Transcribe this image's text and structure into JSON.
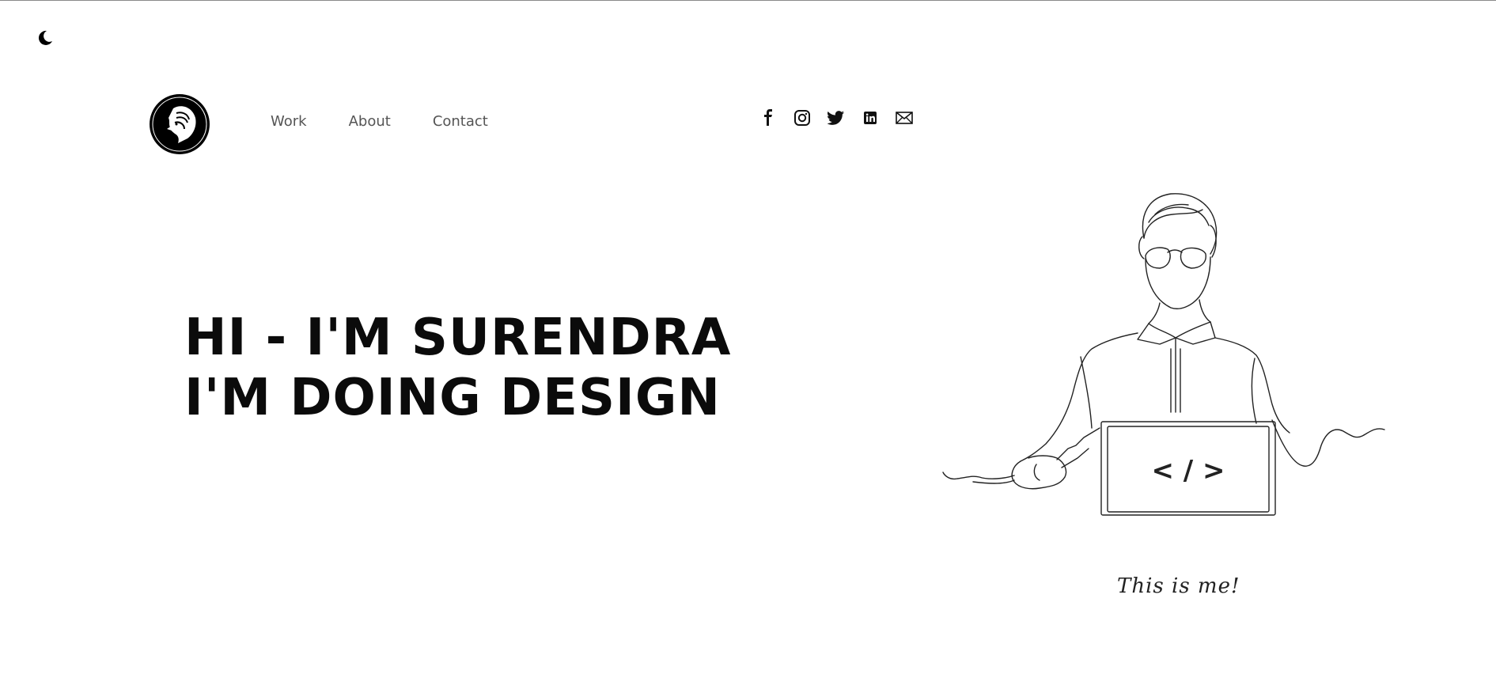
{
  "theme_toggle": {
    "icon": "moon-icon"
  },
  "header": {
    "logo": {
      "icon": "lion-logo-icon"
    },
    "nav": [
      {
        "label": "Work"
      },
      {
        "label": "About"
      },
      {
        "label": "Contact"
      }
    ],
    "social": [
      {
        "icon": "facebook-icon"
      },
      {
        "icon": "instagram-icon"
      },
      {
        "icon": "twitter-icon"
      },
      {
        "icon": "linkedin-icon"
      },
      {
        "icon": "mail-icon"
      }
    ]
  },
  "hero": {
    "line1": "HI - I'M SURENDRA",
    "line2": "I'M DOING DESIGN"
  },
  "illustration": {
    "icon": "developer-line-drawing",
    "screen_symbol": "< / >",
    "caption": "This is me!"
  }
}
